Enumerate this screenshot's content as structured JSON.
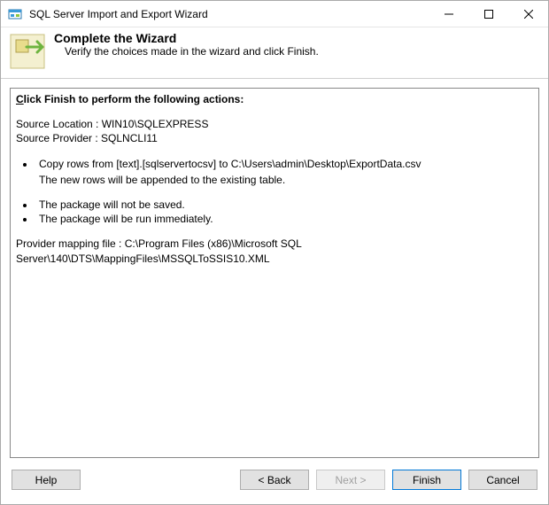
{
  "window": {
    "title": "SQL Server Import and Export Wizard"
  },
  "header": {
    "title": "Complete the Wizard",
    "subtitle": "Verify the choices made in the wizard and click Finish."
  },
  "content": {
    "lead_prefix": "C",
    "lead_rest": "lick Finish to perform the following actions:",
    "source_location_label": "Source Location : ",
    "source_location_value": "WIN10\\SQLEXPRESS",
    "source_provider_label": "Source Provider : ",
    "source_provider_value": "SQLNCLI11",
    "copy_row": "Copy rows from [text].[sqlservertocsv]  to C:\\Users\\admin\\Desktop\\ExportData.csv",
    "copy_note": "The new rows will be appended to the existing table.",
    "pkg_not_saved": "The package will not be saved.",
    "pkg_run_now": "The package will be run immediately.",
    "mapping_label": "Provider mapping file : ",
    "mapping_value": "C:\\Program Files (x86)\\Microsoft SQL Server\\140\\DTS\\MappingFiles\\MSSQLToSSIS10.XML"
  },
  "footer": {
    "help": "Help",
    "back": "< Back",
    "next": "Next >",
    "finish": "Finish",
    "cancel": "Cancel",
    "next_enabled": false
  }
}
